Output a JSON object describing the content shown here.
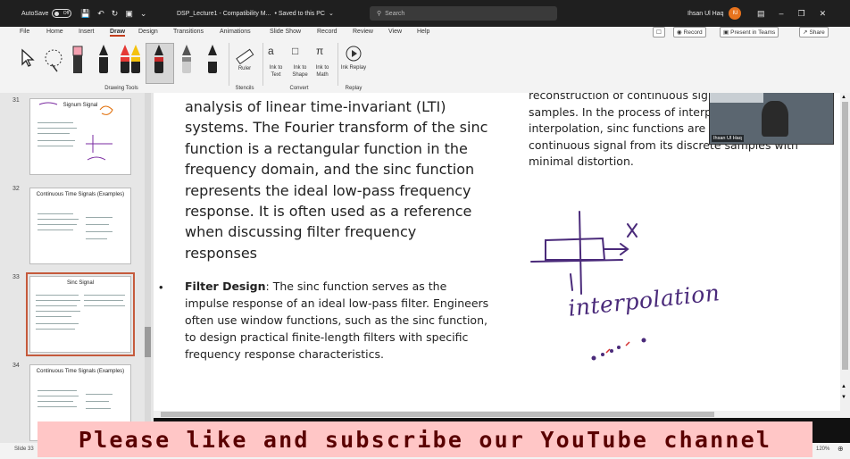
{
  "titlebar": {
    "autosave_label": "AutoSave",
    "autosave_state": "Off",
    "doc_title": "DSP_Lecture1 - Compatibility M...",
    "save_status": "• Saved to this PC",
    "search_placeholder": "Search",
    "user_name": "Ihsan Ul Haq",
    "user_initials": "IU"
  },
  "menu": {
    "tabs": [
      "File",
      "Home",
      "Insert",
      "Draw",
      "Design",
      "Transitions",
      "Animations",
      "Slide Show",
      "Record",
      "Review",
      "View",
      "Help"
    ],
    "active_tab": "Draw",
    "comment_label": "☐",
    "record_label": "Record",
    "present_label": "Present in Teams",
    "share_label": "Share"
  },
  "ribbon": {
    "group_drawing_tools": "Drawing Tools",
    "group_stencils": "Stencils",
    "group_convert": "Convert",
    "group_replay": "Replay",
    "ruler_label": "Ruler",
    "ink_to_text": "Ink to Text",
    "ink_to_shape": "Ink to Shape",
    "ink_to_math": "Ink to Math",
    "ink_replay": "Ink Replay",
    "pen_colors": [
      "#222222",
      "#e53935",
      "#f4c20d",
      "#222222",
      "#c62828",
      "#888888",
      "#222222"
    ]
  },
  "thumbnails": [
    {
      "num": "31",
      "title": "Signum Signal"
    },
    {
      "num": "32",
      "title": "Continuous Time Signals (Examples)"
    },
    {
      "num": "33",
      "title": "Sinc Signal"
    },
    {
      "num": "34",
      "title": "Continuous Time Signals (Examples)"
    }
  ],
  "slide": {
    "left_paragraph": "analysis of linear time-invariant (LTI) systems. The Fourier transform of the sinc function is a rectangular function in the frequency domain, and the sinc function represents the ideal low-pass frequency response. It is often used as a reference when discussing filter frequency responses",
    "bullet_symbol": "•",
    "bullet_title": "Filter Design",
    "bullet_body": ": The sinc function serves as the impulse response of an ideal low-pass filter. Engineers often use window functions, such as the sinc function, to design practical finite-length filters with specific frequency response characteristics.",
    "right_paragraph": "reconstruction of continuous signals from discrete samples. In the process of interpolation or Shannon interpolation, sinc functions are used to reconstruct a continuous signal from its discrete samples with minimal distortion.",
    "handwriting": "interpolation",
    "video_label": "Ihsan Ul Haq",
    "ink_color": "#5a2a8a"
  },
  "status": {
    "slide_info": "Slide 33",
    "zoom": "120%"
  },
  "banner": {
    "text": "Please like and subscribe our YouTube channel"
  }
}
